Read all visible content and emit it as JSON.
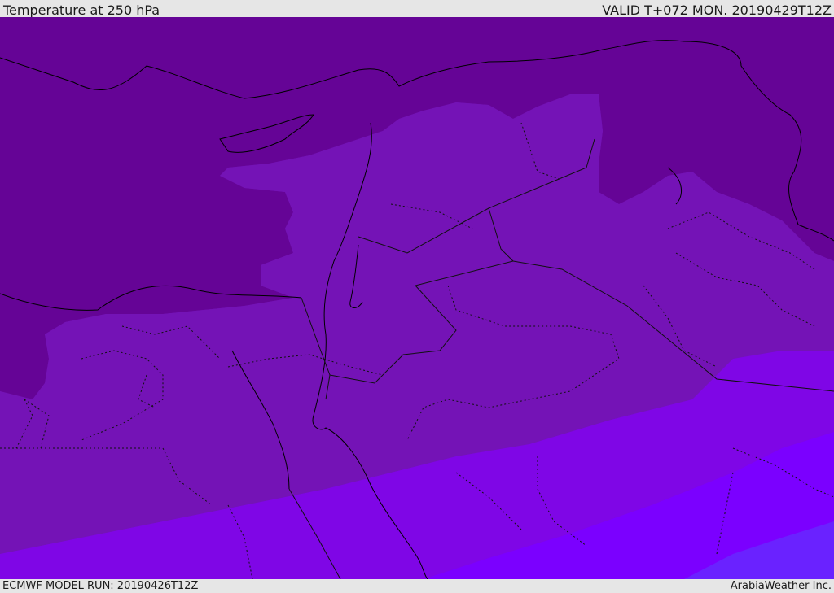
{
  "header": {
    "title": "Temperature at 250 hPa",
    "valid_time": "VALID T+072 MON. 20190429T12Z"
  },
  "footer": {
    "model_run": "ECMWF MODEL RUN: 20190426T12Z",
    "credit": "ArabiaWeather Inc."
  },
  "map": {
    "variable": "Temperature",
    "level": "250 hPa",
    "fill_colors": {
      "coldest": "#650496",
      "cold": "#7210b0",
      "mid": "#7a12c8",
      "warm": "#8000f0",
      "warmer": "#7b00ff",
      "warmest": "#6a22ff"
    },
    "line_colors": {
      "coastline": "#000000",
      "border": "#111111"
    }
  }
}
